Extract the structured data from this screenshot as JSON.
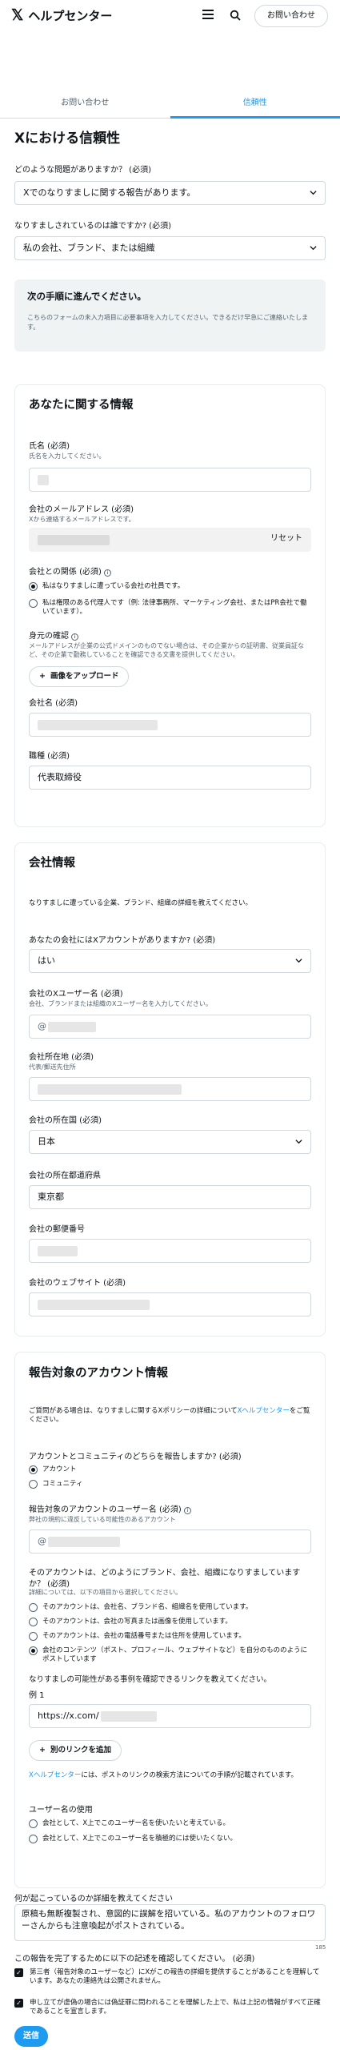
{
  "header": {
    "logo": "𝕏",
    "brand": "ヘルプセンター",
    "contact": "お問い合わせ"
  },
  "tabs": [
    {
      "label": "お問い合わせ"
    },
    {
      "label": "信頼性"
    }
  ],
  "page": {
    "title": "Xにおける信頼性",
    "q1_label": "どのような問題がありますか？ (必須)",
    "q1_value": "Xでのなりすましに関する報告があります。",
    "q2_label": "なりすましされているのは誰ですか? (必須)",
    "q2_value": "私の会社、ブランド、または組織"
  },
  "notice": {
    "title": "次の手順に進んでください。",
    "desc": "こちらのフォームの未入力項目に必要事項を入力してください。できるだけ早急にご連絡いたします。"
  },
  "about": {
    "title": "あなたに関する情報",
    "name_label": "氏名 (必須)",
    "name_sub": "氏名を入力してください。",
    "email_label": "会社のメールアドレス (必須)",
    "email_sub": "Xから連絡するメールアドレスです。",
    "reset": "リセット",
    "relation_label": "会社との関係 (必須)",
    "relation_opt1": "私はなりすましに遭っている会社の社員です。",
    "relation_opt2": "私は権限のある代理人です（例: 法律事務所、マーケティング会社、またはPR会社で働いています）。",
    "id_label": "身元の確認",
    "id_sub": "メールアドレスが企業の公式ドメインのものでない場合は、その企業からの証明書、従業員証など、その企業で勤務していることを確認できる文書を提供してください。",
    "upload": "画像をアップロード",
    "company_label": "会社名 (必須)",
    "title_label": "職種 (必須)",
    "title_value": "代表取締役"
  },
  "company": {
    "title": "会社情報",
    "desc": "なりすましに遭っている企業、ブランド、組織の詳細を教えてください。",
    "has_account_label": "あなたの会社にはXアカウントがありますか? (必須)",
    "has_account_value": "はい",
    "username_label": "会社のXユーザー名 (必須)",
    "username_sub": "会社、ブランドまたは組織のXユーザー名を入力してください。",
    "username_prefix": "@",
    "address_label": "会社所在地 (必須)",
    "address_sub": "代表/郵送先住所",
    "country_label": "会社の所在国 (必須)",
    "country_value": "日本",
    "pref_label": "会社の所在都道府県",
    "pref_value": "東京都",
    "zip_label": "会社の郵便番号",
    "site_label": "会社のウェブサイト (必須)"
  },
  "report": {
    "title": "報告対象のアカウント情報",
    "desc_pre": "ご質問がある場合は、なりすましに関するXポリシーの詳細について",
    "desc_link": "Xヘルプセンター",
    "desc_post": "をご覧ください。",
    "type_label": "アカウントとコミュニティのどちらを報告しますか? (必須)",
    "type_opt1": "アカウント",
    "type_opt2": "コミュニティ",
    "username_label": "報告対象のアカウントのユーザー名 (必須)",
    "username_sub": "弊社の規約に違反している可能性のあるアカウント",
    "username_prefix": "@",
    "how_label": "そのアカウントは、どのようにブランド、会社、組織になりすましていますか？ (必須)",
    "how_sub": "詳細については、以下の項目から選択してください。",
    "how_opt1": "そのアカウントは、会社名、ブランド名、組織名を使用しています。",
    "how_opt2": "そのアカウントは、会社の写真または画像を使用しています。",
    "how_opt3": "そのアカウントは、会社の電話番号または住所を使用しています。",
    "how_opt4": "会社のコンテンツ（ポスト、プロフィール、ウェブサイトなど）を自分のもののようにポストしています",
    "links_label": "なりすましの可能性がある事例を確認できるリンクを教えてください。",
    "example_label": "例 1",
    "link_prefix": "https://x.com/",
    "add_link": "別のリンクを追加",
    "help_link": "Xヘルプセンター",
    "help_post": "には、ポストのリンクの検索方法についての手順が記載されています。",
    "use_label": "ユーザー名の使用",
    "use_opt1": "会社として、X上でこのユーザー名を使いたいと考えている。",
    "use_opt2": "会社として、X上でこのユーザー名を積極的には使いたくない。"
  },
  "details": {
    "label": "何が起こっているのか詳細を教えてください",
    "text": "原稿も無断複製され、意図的に誤解を招いている。私のアカウントのフォロワーさんからも注意喚起がポストされている。",
    "counter": "185"
  },
  "confirm": {
    "label": "この報告を完了するために以下の記述を確認してください。 (必須)",
    "check1": "第三者（報告対象のユーザーなど）にXがこの報告の詳細を提供することがあることを理解しています。あなたの連絡先は公開されません。",
    "check2": "申し立てが虚偽の場合には偽証罪に問われることを理解した上で、私は上記の情報がすべて正確であることを宣言します。"
  },
  "submit": "送信"
}
